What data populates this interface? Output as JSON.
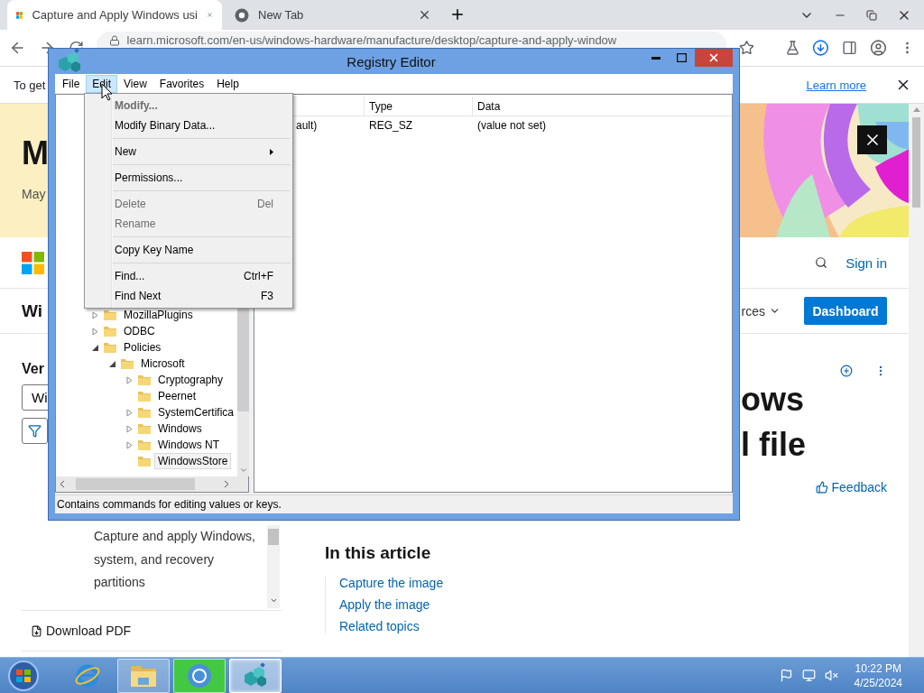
{
  "browser": {
    "tabs": [
      {
        "kind": "site",
        "title": "Capture and Apply Windows usi",
        "selected": true
      },
      {
        "kind": "newtab",
        "title": "New Tab",
        "selected": false
      }
    ],
    "address": "learn.microsoft.com/en-us/windows-hardware/manufacture/desktop/capture-and-apply-window",
    "infobar": {
      "text": "To get",
      "link": "Learn more"
    }
  },
  "page": {
    "hero": {
      "title": "M",
      "date": "May"
    },
    "header": {
      "sign_in": "Sign in"
    },
    "nav": {
      "title": "Wi",
      "menu_item": "rces",
      "button": "Dashboard"
    },
    "sidebar": {
      "version_label": "Ver",
      "version_value": "Wi",
      "toc_text": "Capture and apply Windows, system, and recovery partitions",
      "download": "Download PDF"
    },
    "article": {
      "heading": [
        "ows",
        "l file"
      ],
      "feedback": "Feedback",
      "toc_title": "In this article",
      "toc_links": [
        "Capture the image",
        "Apply the image",
        "Related topics"
      ]
    }
  },
  "regedit": {
    "title": "Registry Editor",
    "menu": [
      {
        "label": "File",
        "selected": false
      },
      {
        "label": "Edit",
        "selected": true
      },
      {
        "label": "View",
        "selected": false
      },
      {
        "label": "Favorites",
        "selected": false
      },
      {
        "label": "Help",
        "selected": false
      }
    ],
    "edit_menu": [
      {
        "kind": "item",
        "label": "Modify...",
        "default": true,
        "disabled": true,
        "submenu": false
      },
      {
        "kind": "item",
        "label": "Modify Binary Data...",
        "default": false,
        "disabled": false,
        "submenu": false
      },
      {
        "kind": "separator"
      },
      {
        "kind": "item",
        "label": "New",
        "default": false,
        "disabled": false,
        "submenu": true
      },
      {
        "kind": "separator"
      },
      {
        "kind": "item",
        "label": "Permissions...",
        "default": false,
        "disabled": false,
        "submenu": false
      },
      {
        "kind": "separator"
      },
      {
        "kind": "item",
        "label": "Delete",
        "shortcut": "Del",
        "default": false,
        "disabled": true,
        "submenu": false
      },
      {
        "kind": "item",
        "label": "Rename",
        "default": false,
        "disabled": true,
        "submenu": false
      },
      {
        "kind": "separator"
      },
      {
        "kind": "item",
        "label": "Copy Key Name",
        "default": false,
        "disabled": false,
        "submenu": false
      },
      {
        "kind": "separator"
      },
      {
        "kind": "item",
        "label": "Find...",
        "shortcut": "Ctrl+F",
        "default": false,
        "disabled": false,
        "submenu": false
      },
      {
        "kind": "item",
        "label": "Find Next",
        "shortcut": "F3",
        "default": false,
        "disabled": false,
        "submenu": false
      }
    ],
    "tree": [
      {
        "label": "MozillaPlugins",
        "has_children": true,
        "expanded": false,
        "selected": false
      },
      {
        "label": "ODBC",
        "has_children": true,
        "expanded": false,
        "selected": false
      },
      {
        "label": "Policies",
        "has_children": true,
        "expanded": true,
        "selected": false,
        "children": [
          {
            "label": "Microsoft",
            "has_children": true,
            "expanded": true,
            "selected": false,
            "children": [
              {
                "label": "Cryptography",
                "has_children": true,
                "expanded": false,
                "selected": false
              },
              {
                "label": "Peernet",
                "has_children": false,
                "selected": false
              },
              {
                "label": "SystemCertifica",
                "has_children": true,
                "expanded": false,
                "selected": false
              },
              {
                "label": "Windows",
                "has_children": true,
                "expanded": false,
                "selected": false
              },
              {
                "label": "Windows NT",
                "has_children": true,
                "expanded": false,
                "selected": false
              },
              {
                "label": "WindowsStore",
                "has_children": false,
                "selected": true
              }
            ]
          }
        ]
      }
    ],
    "values": {
      "columns": [
        "Type",
        "Data"
      ],
      "rows": [
        {
          "name": "ault)",
          "type": "REG_SZ",
          "data": "(value not set)"
        }
      ]
    },
    "status": "Contains commands for editing values or keys."
  },
  "taskbar": {
    "apps": [
      {
        "kind": "ie",
        "running": false,
        "highlighted": false,
        "selected": false
      },
      {
        "kind": "explorer",
        "running": true,
        "highlighted": false,
        "selected": false
      },
      {
        "kind": "chrome",
        "running": true,
        "highlighted": true,
        "selected": false
      },
      {
        "kind": "regedit",
        "running": true,
        "highlighted": false,
        "selected": true
      }
    ],
    "time": "10:22 PM",
    "date": "4/25/2024"
  }
}
